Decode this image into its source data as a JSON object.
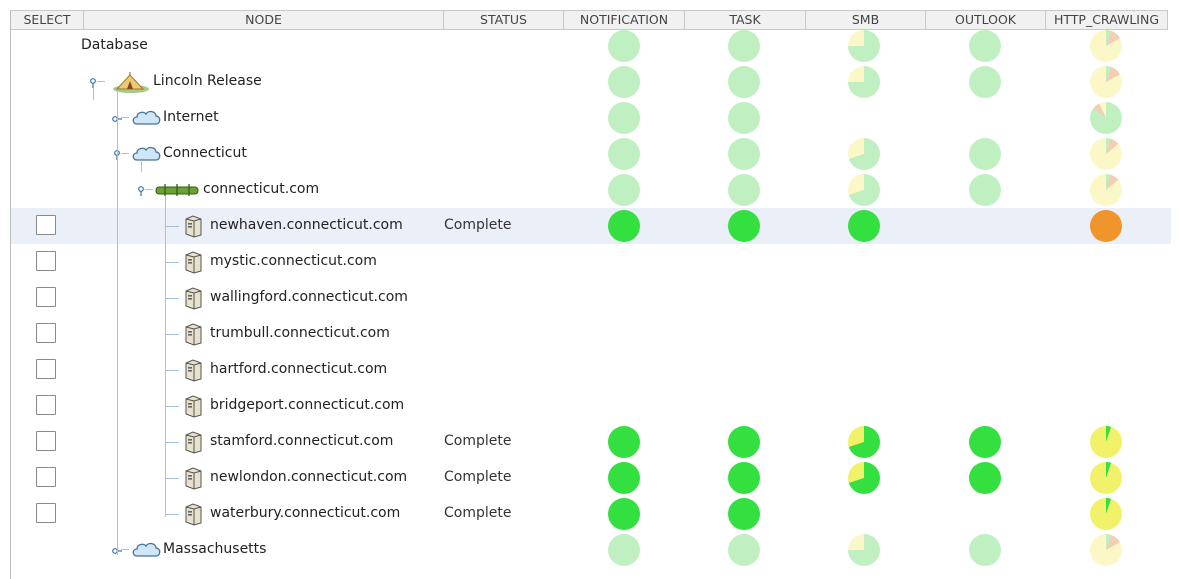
{
  "columns": [
    "SELECT",
    "NODE",
    "STATUS",
    "NOTIFICATION",
    "TASK",
    "SMB",
    "OUTLOOK",
    "HTTP_CRAWLING"
  ],
  "colors": {
    "green": "#33e040",
    "light_green": "#c0f0c2",
    "yellow": "#f2f26a",
    "light_yellow": "#fbf7c6",
    "orange": "#f0952c",
    "light_orange": "#f0cfb4",
    "selected_row": "#ebeff7"
  },
  "rows": [
    {
      "label": "Database",
      "icon": "database-root",
      "status": "",
      "checkbox": false,
      "notification": {
        "style": "light",
        "green": 1
      },
      "task": {
        "style": "light",
        "green": 1
      },
      "smb": {
        "style": "light",
        "green": 0.75
      },
      "outlook": {
        "style": "light",
        "green": 1
      },
      "http": {
        "style": "light",
        "green": 0.05,
        "orange": 0.12
      }
    },
    {
      "label": "Lincoln Release",
      "icon": "camp-tent-icon",
      "status": "",
      "checkbox": false,
      "notification": {
        "style": "light",
        "green": 1
      },
      "task": {
        "style": "light",
        "green": 1
      },
      "smb": {
        "style": "light",
        "green": 0.75
      },
      "outlook": {
        "style": "light",
        "green": 1
      },
      "http": {
        "style": "light",
        "green": 0.05,
        "orange": 0.12
      }
    },
    {
      "label": "Internet",
      "icon": "cloud-icon",
      "status": "",
      "checkbox": false,
      "notification": {
        "style": "light",
        "green": 1
      },
      "task": {
        "style": "light",
        "green": 1
      },
      "smb": null,
      "outlook": null,
      "http": {
        "style": "light",
        "green": 0.85,
        "orange": 0.08
      }
    },
    {
      "label": "Connecticut",
      "icon": "cloud-icon",
      "status": "",
      "checkbox": false,
      "notification": {
        "style": "light",
        "green": 1
      },
      "task": {
        "style": "light",
        "green": 1
      },
      "smb": {
        "style": "light",
        "green": 0.7
      },
      "outlook": {
        "style": "light",
        "green": 1
      },
      "http": {
        "style": "light",
        "green": 0.04,
        "orange": 0.1
      }
    },
    {
      "label": "connecticut.com",
      "icon": "domain-bar-icon",
      "status": "",
      "checkbox": false,
      "notification": {
        "style": "light",
        "green": 1
      },
      "task": {
        "style": "light",
        "green": 1
      },
      "smb": {
        "style": "light",
        "green": 0.7
      },
      "outlook": {
        "style": "light",
        "green": 1
      },
      "http": {
        "style": "light",
        "green": 0.04,
        "orange": 0.1
      }
    },
    {
      "label": "newhaven.connecticut.com",
      "icon": "server-icon",
      "status": "Complete",
      "checkbox": true,
      "selected": true,
      "notification": {
        "style": "full",
        "green": 1
      },
      "task": {
        "style": "full",
        "green": 1
      },
      "smb": {
        "style": "full",
        "green": 1
      },
      "outlook": null,
      "http": {
        "style": "full",
        "orange_full": true
      }
    },
    {
      "label": "mystic.connecticut.com",
      "icon": "server-icon",
      "status": "",
      "checkbox": true,
      "notification": null,
      "task": null,
      "smb": null,
      "outlook": null,
      "http": null
    },
    {
      "label": "wallingford.connecticut.com",
      "icon": "server-icon",
      "status": "",
      "checkbox": true,
      "notification": null,
      "task": null,
      "smb": null,
      "outlook": null,
      "http": null
    },
    {
      "label": "trumbull.connecticut.com",
      "icon": "server-icon",
      "status": "",
      "checkbox": true,
      "notification": null,
      "task": null,
      "smb": null,
      "outlook": null,
      "http": null
    },
    {
      "label": "hartford.connecticut.com",
      "icon": "server-icon",
      "status": "",
      "checkbox": true,
      "notification": null,
      "task": null,
      "smb": null,
      "outlook": null,
      "http": null
    },
    {
      "label": "bridgeport.connecticut.com",
      "icon": "server-icon",
      "status": "",
      "checkbox": true,
      "notification": null,
      "task": null,
      "smb": null,
      "outlook": null,
      "http": null
    },
    {
      "label": "stamford.connecticut.com",
      "icon": "server-icon",
      "status": "Complete",
      "checkbox": true,
      "notification": {
        "style": "full",
        "green": 1
      },
      "task": {
        "style": "full",
        "green": 1
      },
      "smb": {
        "style": "full",
        "green": 0.7
      },
      "outlook": {
        "style": "full",
        "green": 1
      },
      "http": {
        "style": "full",
        "green": 0.05
      }
    },
    {
      "label": "newlondon.connecticut.com",
      "icon": "server-icon",
      "status": "Complete",
      "checkbox": true,
      "notification": {
        "style": "full",
        "green": 1
      },
      "task": {
        "style": "full",
        "green": 1
      },
      "smb": {
        "style": "full",
        "green": 0.7
      },
      "outlook": {
        "style": "full",
        "green": 1
      },
      "http": {
        "style": "full",
        "green": 0.05
      }
    },
    {
      "label": "waterbury.connecticut.com",
      "icon": "server-icon",
      "status": "Complete",
      "checkbox": true,
      "notification": {
        "style": "full",
        "green": 1
      },
      "task": {
        "style": "full",
        "green": 1
      },
      "smb": null,
      "outlook": null,
      "http": {
        "style": "full",
        "green": 0.05
      }
    },
    {
      "label": "Massachusetts",
      "icon": "cloud-icon",
      "status": "",
      "checkbox": false,
      "notification": {
        "style": "light",
        "green": 1
      },
      "task": {
        "style": "light",
        "green": 1
      },
      "smb": {
        "style": "light",
        "green": 0.75
      },
      "outlook": {
        "style": "light",
        "green": 1
      },
      "http": {
        "style": "light",
        "green": 0.05,
        "orange": 0.12
      }
    }
  ]
}
